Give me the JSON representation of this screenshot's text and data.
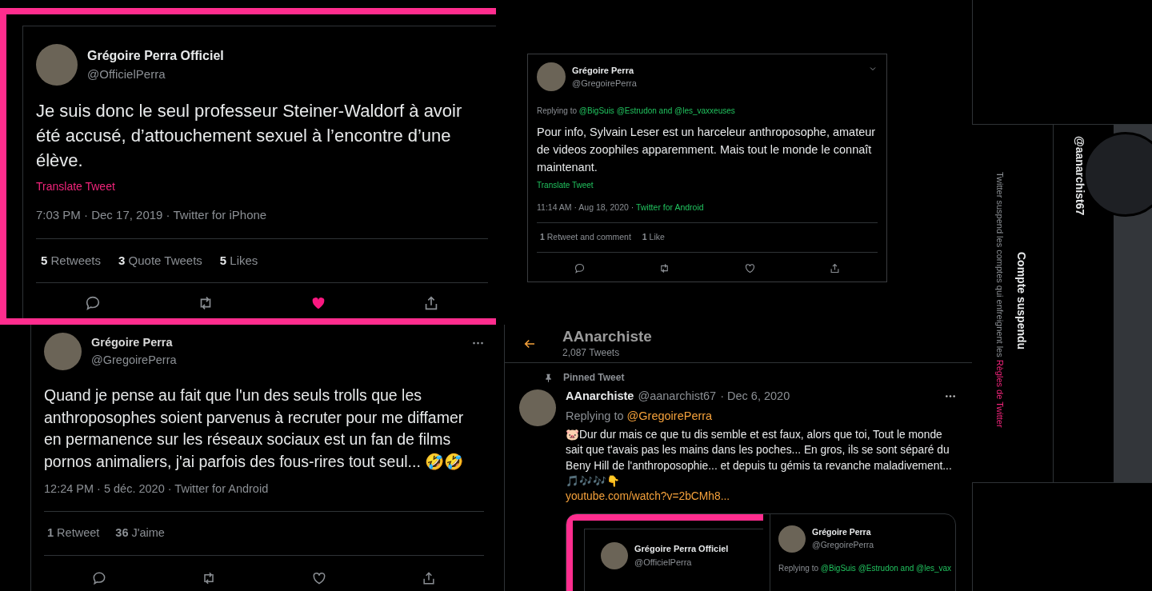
{
  "tweet_officiel": {
    "name": "Grégoire Perra Officiel",
    "handle": "@OfficielPerra",
    "text": "Je suis donc le seul professeur Steiner-Waldorf à avoir été accusé, d’attouchement sexuel à l’encontre d’une élève.",
    "translate": "Translate Tweet",
    "meta": "7:03 PM · Dec 17, 2019 · Twitter for iPhone",
    "stats": [
      "**5** Retweets",
      "**3** Quote Tweets",
      "**5** Likes"
    ],
    "liked": true
  },
  "tweet_reply": {
    "name": "Grégoire Perra",
    "handle": "@GregoirePerra",
    "replying_prefix": "Replying to",
    "replying_mentions": "@BigSuis @Estrudon and @les_vaxxeuses",
    "text": "Pour info, Sylvain Leser est un harceleur anthroposophe, amateur de videos zoophiles apparemment.  Mais tout le monde le connaît maintenant.",
    "translate": "Translate Tweet",
    "meta": "11:14 AM · Aug 18, 2020 · ",
    "source": "Twitter for Android",
    "stats": [
      "**1** Retweet and comment",
      "**1** Like"
    ],
    "liked": false
  },
  "tweet_gregoire": {
    "name": "Grégoire Perra",
    "handle": "@GregoirePerra",
    "text": "Quand je pense au fait que l'un des seuls trolls que les anthroposophes soient parvenus à recruter pour me diffamer en permanence sur les réseaux sociaux est un fan de films pornos animaliers, j'ai parfois des fous-rires tout seul... 🤣🤣",
    "meta": "12:24 PM · 5 déc. 2020 · Twitter for Android",
    "stats": [
      "**1** Retweet",
      "**36** J'aime"
    ],
    "liked": false
  },
  "profile": {
    "title": "AAnarchiste",
    "tweet_count": "2,087 Tweets",
    "pinned_label": "Pinned Tweet",
    "tweet": {
      "name": "AAnarchiste",
      "handle": "@aanarchist67",
      "date": "· Dec 6, 2020",
      "replying_prefix": "Replying to",
      "replying_mentions": "@GregoirePerra",
      "text": "🐷Dur dur mais ce que tu dis semble et est faux, alors que toi, Tout le monde sait que t'avais pas les mains dans les poches... En gros, ils se sont séparé du Beny Hill de l'anthroposophie... et depuis tu gémis ta revanche maladivement...",
      "emojis": "🎵🎶🎶👇",
      "link": "youtube.com/watch?v=2bCMh8...",
      "quoted": [
        {
          "name": "Grégoire Perra Officiel",
          "handle": "@OfficielPerra"
        },
        {
          "name": "Grégoire Perra",
          "handle": "@GregoirePerra",
          "replying_prefix": "Replying to",
          "replying_mentions": "@BigSuis @Estrudon and @les_vax"
        }
      ]
    }
  },
  "suspended": {
    "handle": "@aanarchist67",
    "title": "Compte suspendu",
    "message": "Twitter suspend les comptes qui enfreignent les ",
    "rules_link": "Règles de Twitter"
  }
}
